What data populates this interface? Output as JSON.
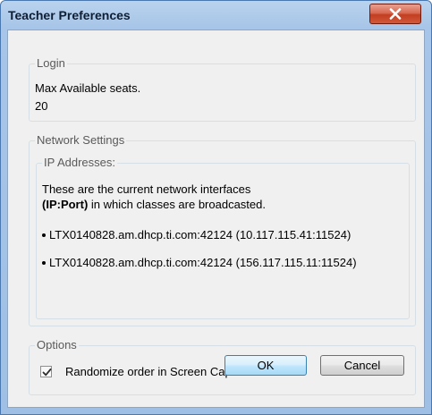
{
  "window": {
    "title": "Teacher Preferences",
    "close_label": "x"
  },
  "login": {
    "legend": "Login",
    "seats_label": "Max Available seats.",
    "seats_value": "20"
  },
  "network": {
    "legend": "Network Settings",
    "ip": {
      "legend": "IP Addresses:",
      "description_line1": "These are the current network interfaces",
      "description_bold": "(IP:Port)",
      "description_rest": " in which classes are broadcasted.",
      "addresses": [
        "LTX0140828.am.dhcp.ti.com:42124 (10.117.115.41:11524)",
        "LTX0140828.am.dhcp.ti.com:42124 (156.117.115.11:11524)"
      ]
    }
  },
  "options": {
    "legend": "Options",
    "randomize_label": "Randomize order in Screen Capture",
    "randomize_checked": true
  },
  "buttons": {
    "ok_label": "OK",
    "cancel_label": "Cancel"
  },
  "colors": {
    "title_bar": "#a7c5e8",
    "close_button": "#c23e22",
    "dialog_background": "#f0f0f0",
    "ok_button_border": "#3c7fb1"
  }
}
